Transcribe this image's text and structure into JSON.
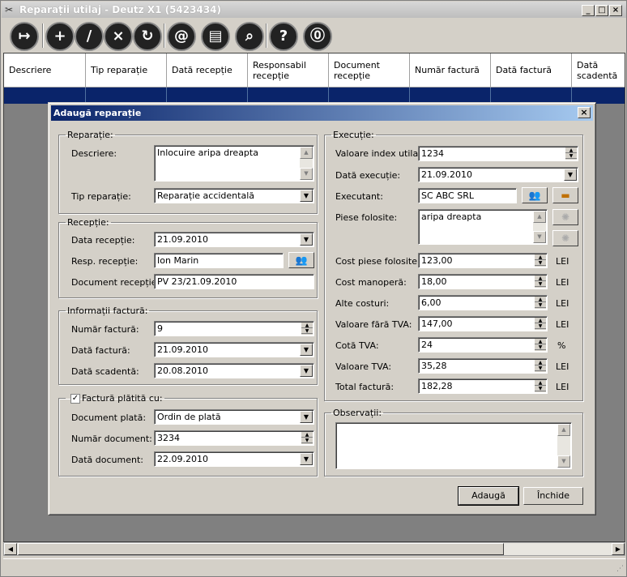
{
  "window": {
    "title": "Reparații utilaj - Deutz X1 (5423434)",
    "minimize": "_",
    "maximize": "□",
    "close": "×"
  },
  "toolbar": [
    {
      "name": "exit-icon",
      "glyph": "↦"
    },
    {
      "name": "add-icon",
      "glyph": "+"
    },
    {
      "name": "edit-icon",
      "glyph": "/"
    },
    {
      "name": "delete-icon",
      "glyph": "×"
    },
    {
      "name": "refresh-icon",
      "glyph": "↻"
    },
    {
      "name": "email-icon",
      "glyph": "@"
    },
    {
      "name": "print-icon",
      "glyph": "▤"
    },
    {
      "name": "search-icon",
      "glyph": "⌕"
    },
    {
      "name": "help-icon",
      "glyph": "?"
    },
    {
      "name": "info-icon",
      "glyph": "⓪"
    }
  ],
  "grid": {
    "columns": [
      "Descriere",
      "Tip reparație",
      "Dată recepție",
      "Responsabil recepție",
      "Document recepție",
      "Număr factură",
      "Dată factură",
      "Dată scadentă"
    ]
  },
  "dialog": {
    "title": "Adaugă reparație",
    "close": "×",
    "reparatie": {
      "legend": "Reparație:",
      "descriere_label": "Descriere:",
      "descriere_value": "Inlocuire aripa dreapta",
      "tip_label": "Tip reparație:",
      "tip_value": "Reparație accidentală"
    },
    "receptie": {
      "legend": "Recepție:",
      "data_label": "Data recepție:",
      "data_value": "21.09.2010",
      "resp_label": "Resp. recepție:",
      "resp_value": "Ion Marin",
      "doc_label": "Document recepție:",
      "doc_value": "PV 23/21.09.2010"
    },
    "factura": {
      "legend": "Informații factură:",
      "numar_label": "Număr factură:",
      "numar_value": "9",
      "data_label": "Dată factură:",
      "data_value": "21.09.2010",
      "scad_label": "Dată scadentă:",
      "scad_value": "20.08.2010"
    },
    "plata": {
      "legend": "Factură plătită cu:",
      "checked": "✓",
      "doc_label": "Document plată:",
      "doc_value": "Ordin de plată",
      "nr_label": "Număr document:",
      "nr_value": "3234",
      "data_label": "Dată document:",
      "data_value": "22.09.2010"
    },
    "executie": {
      "legend": "Execuție:",
      "index_label": "Valoare index utilaj:",
      "index_value": "1234",
      "data_label": "Dată execuție:",
      "data_value": "21.09.2010",
      "executant_label": "Executant:",
      "executant_value": "SC ABC SRL",
      "piese_label": "Piese folosite:",
      "piese_value": "aripa dreapta",
      "cost_piese_label": "Cost piese folosite:",
      "cost_piese_value": "123,00",
      "manopera_label": "Cost manoperă:",
      "manopera_value": "18,00",
      "alte_label": "Alte costuri:",
      "alte_value": "6,00",
      "fara_tva_label": "Valoare fără TVA:",
      "fara_tva_value": "147,00",
      "cota_label": "Cotă TVA:",
      "cota_value": "24",
      "tva_label": "Valoare TVA:",
      "tva_value": "35,28",
      "total_label": "Total factură:",
      "total_value": "182,28",
      "unit_lei": "LEI",
      "unit_pct": "%"
    },
    "observatii": {
      "legend": "Observații:"
    },
    "buttons": {
      "add": "Adaugă",
      "close": "Închide"
    }
  }
}
